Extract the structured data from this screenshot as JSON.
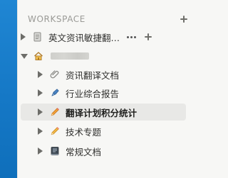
{
  "workspace": {
    "title": "WORKSPACE"
  },
  "items": [
    {
      "label": "英文资讯敏捷翻…",
      "icon": "document-icon",
      "expanded": false,
      "show_actions": true
    },
    {
      "label": "",
      "icon": "house-icon",
      "expanded": true,
      "label_redacted": true
    },
    {
      "label": "资讯翻译文档",
      "icon": "paperclip-icon",
      "expanded": false
    },
    {
      "label": "行业综合报告",
      "icon": "pen-icon",
      "expanded": false
    },
    {
      "label": "翻译计划积分统计",
      "icon": "pencil-icon",
      "expanded": false,
      "selected": true
    },
    {
      "label": "技术专题",
      "icon": "pencil-icon",
      "expanded": false
    },
    {
      "label": "常规文档",
      "icon": "book-icon",
      "expanded": false
    }
  ],
  "colors": {
    "left_accent": "#1f86d3",
    "sidebar_bg": "#f7f7f5",
    "selected_row": "#e8e8e6"
  }
}
